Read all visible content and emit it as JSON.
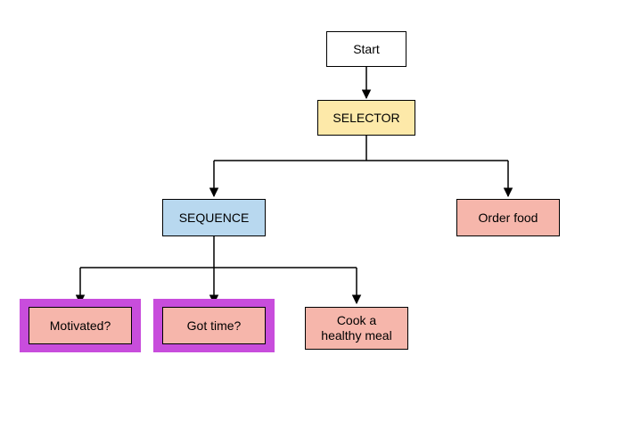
{
  "nodes": {
    "start": {
      "label": "Start"
    },
    "selector": {
      "label": "SELECTOR"
    },
    "sequence": {
      "label": "SEQUENCE"
    },
    "order": {
      "label": "Order food"
    },
    "motivated": {
      "label": "Motivated?"
    },
    "gottime": {
      "label": "Got time?"
    },
    "cook": {
      "label": "Cook a\nhealthy meal"
    }
  },
  "chart_data": {
    "type": "tree",
    "title": "",
    "nodes": [
      {
        "id": "start",
        "label": "Start",
        "kind": "root",
        "fill": "#ffffff",
        "highlighted": false
      },
      {
        "id": "selector",
        "label": "SELECTOR",
        "kind": "selector",
        "fill": "#fde9a9",
        "highlighted": false
      },
      {
        "id": "sequence",
        "label": "SEQUENCE",
        "kind": "sequence",
        "fill": "#b8d8ef",
        "highlighted": false
      },
      {
        "id": "order",
        "label": "Order food",
        "kind": "action",
        "fill": "#f6b6ab",
        "highlighted": false
      },
      {
        "id": "motivated",
        "label": "Motivated?",
        "kind": "condition",
        "fill": "#f6b6ab",
        "highlighted": true
      },
      {
        "id": "gottime",
        "label": "Got time?",
        "kind": "condition",
        "fill": "#f6b6ab",
        "highlighted": true
      },
      {
        "id": "cook",
        "label": "Cook a healthy meal",
        "kind": "action",
        "fill": "#f6b6ab",
        "highlighted": false
      }
    ],
    "edges": [
      {
        "from": "start",
        "to": "selector"
      },
      {
        "from": "selector",
        "to": "sequence"
      },
      {
        "from": "selector",
        "to": "order"
      },
      {
        "from": "sequence",
        "to": "motivated"
      },
      {
        "from": "sequence",
        "to": "gottime"
      },
      {
        "from": "sequence",
        "to": "cook"
      }
    ],
    "highlight_color": "#c84ddc"
  }
}
